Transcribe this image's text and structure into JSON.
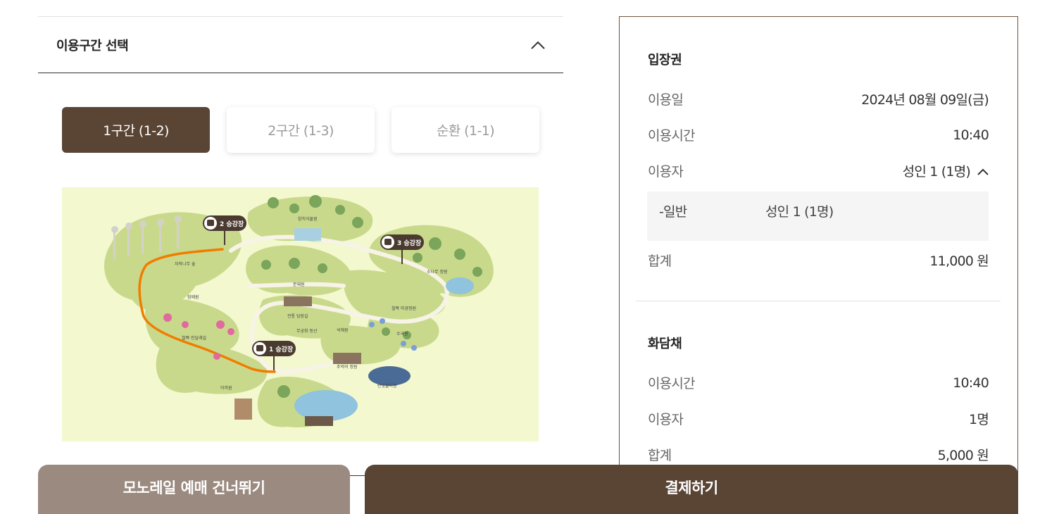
{
  "section": {
    "title": "이용구간 선택",
    "toggle_icon": "chevron-up-icon"
  },
  "route_tabs": [
    {
      "label": "1구간 (1-2)",
      "active": true
    },
    {
      "label": "2구간 (1-3)",
      "active": false
    },
    {
      "label": "순환 (1-1)",
      "active": false
    }
  ],
  "map": {
    "stations": [
      "1 승강장",
      "2 승강장",
      "3 승강장"
    ],
    "places": [
      "자작나무 숲",
      "양치식물원",
      "분재원",
      "소나무 정원",
      "철쭉·진달래길",
      "함때원",
      "전통 담장길",
      "무궁화 동산",
      "석채원",
      "수국원",
      "추억의 정원",
      "반딧불이원",
      "이끼원",
      "철쭉 미경정원"
    ],
    "colors": {
      "background": "#f3f8cf",
      "route": "#f07d00",
      "pin": "#4a3a30"
    }
  },
  "summary": {
    "ticket": {
      "title": "입장권",
      "date_label": "이용일",
      "date_value": "2024년 08월 09일(금)",
      "time_label": "이용시간",
      "time_value": "10:40",
      "user_label": "이용자",
      "user_value": "성인 1 (1명)",
      "detail_key": "-일반",
      "detail_value": "성인 1 (1명)",
      "total_label": "합계",
      "total_value": "11,000 원"
    },
    "hwadamchae": {
      "title": "화담채",
      "time_label": "이용시간",
      "time_value": "10:40",
      "user_label": "이용자",
      "user_value": "1명",
      "total_label": "합계",
      "total_value": "5,000 원"
    }
  },
  "actions": {
    "skip_label": "모노레일 예매 건너뛰기",
    "pay_label": "결제하기"
  },
  "colors": {
    "brand": "#5a4535",
    "skip_button": "#9a8a80",
    "panel_border": "#6e5340"
  }
}
